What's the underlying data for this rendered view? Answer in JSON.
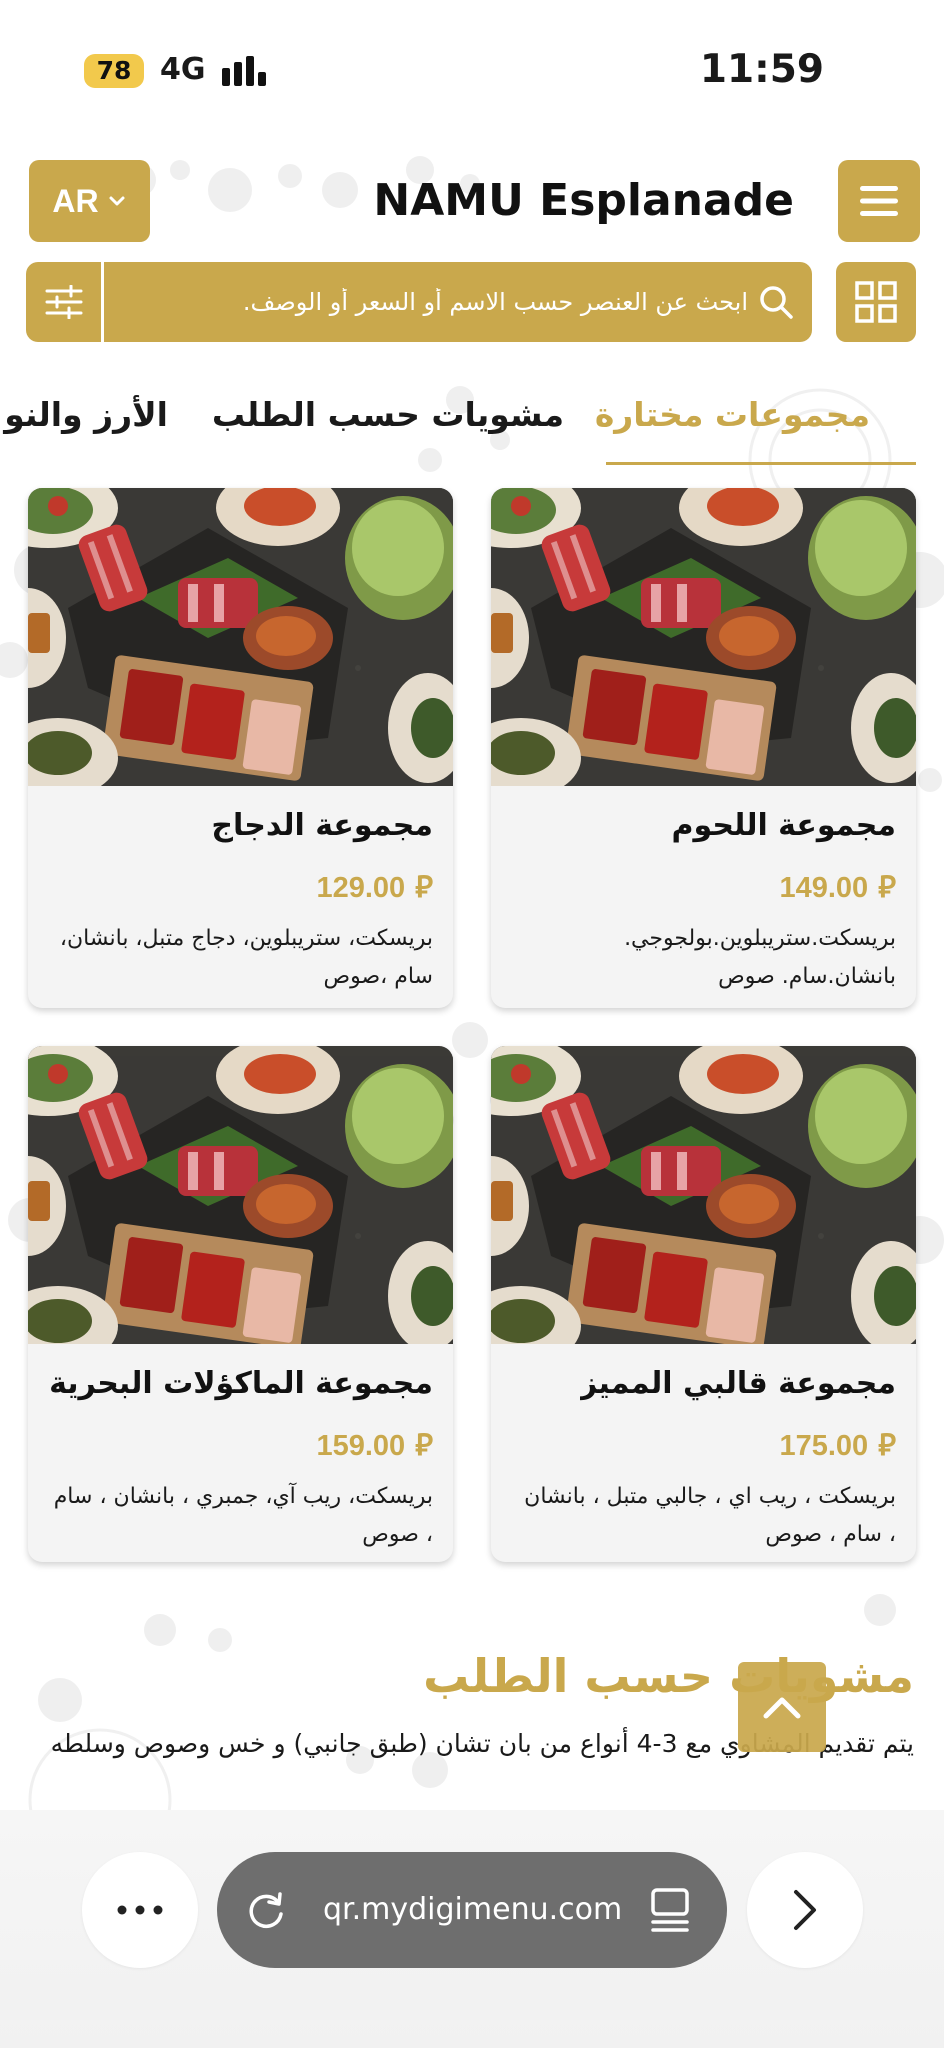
{
  "status_bar": {
    "battery": "78",
    "network": "4G",
    "time": "11:59"
  },
  "header": {
    "language": "AR",
    "title": "NAMU Esplanade"
  },
  "search": {
    "placeholder": "ابحث عن العنصر حسب الاسم أو السعر أو الوصف."
  },
  "tabs": [
    {
      "label": "مجموعات مختارة",
      "active": true
    },
    {
      "label": "مشويات حسب الطلب",
      "active": false
    },
    {
      "label": "الأرز والنو",
      "active": false
    }
  ],
  "products": [
    {
      "name": "مجموعة اللحوم",
      "price": "149.00",
      "currency_symbol": "⃁",
      "description": "بريسكت.ستريبلوين.بولجوجي. بانشان.سام. صوص"
    },
    {
      "name": "مجموعة الدجاج",
      "price": "129.00",
      "currency_symbol": "⃁",
      "description": "بريسكت، ستريبلوين، دجاج متبل، بانشان، سام ،صوص"
    },
    {
      "name": "مجموعة قالبي المميز",
      "price": "175.00",
      "currency_symbol": "⃁",
      "description": "بريسكت ، ريب اي ، جالبي متبل ، بانشان ، سام ، صوص"
    },
    {
      "name": "مجموعة الماكؤلات البحرية",
      "price": "159.00",
      "currency_symbol": "⃁",
      "description": "بريسكت، ريب آي، جمبري ، بانشان ، سام ، صوص"
    }
  ],
  "section": {
    "title": "مشويات حسب الطلب",
    "description": "يتم تقديم المشاوي مع 3-4 أنواع من بان تشان (طبق جانبي) و خس وصوص وسلطه"
  },
  "browser": {
    "url": "qr.mydigimenu.com"
  },
  "colors": {
    "accent": "#c9a84c",
    "card_bg": "#f4f4f4",
    "url_bar": "#6e6e6e"
  },
  "icons": [
    "chevron-down-icon",
    "hamburger-menu-icon",
    "grid-view-icon",
    "filter-sliders-icon",
    "search-icon",
    "riyal-currency-icon",
    "chevron-up-icon",
    "more-dots-icon",
    "reload-icon",
    "tabs-icon",
    "forward-chevron-icon"
  ]
}
